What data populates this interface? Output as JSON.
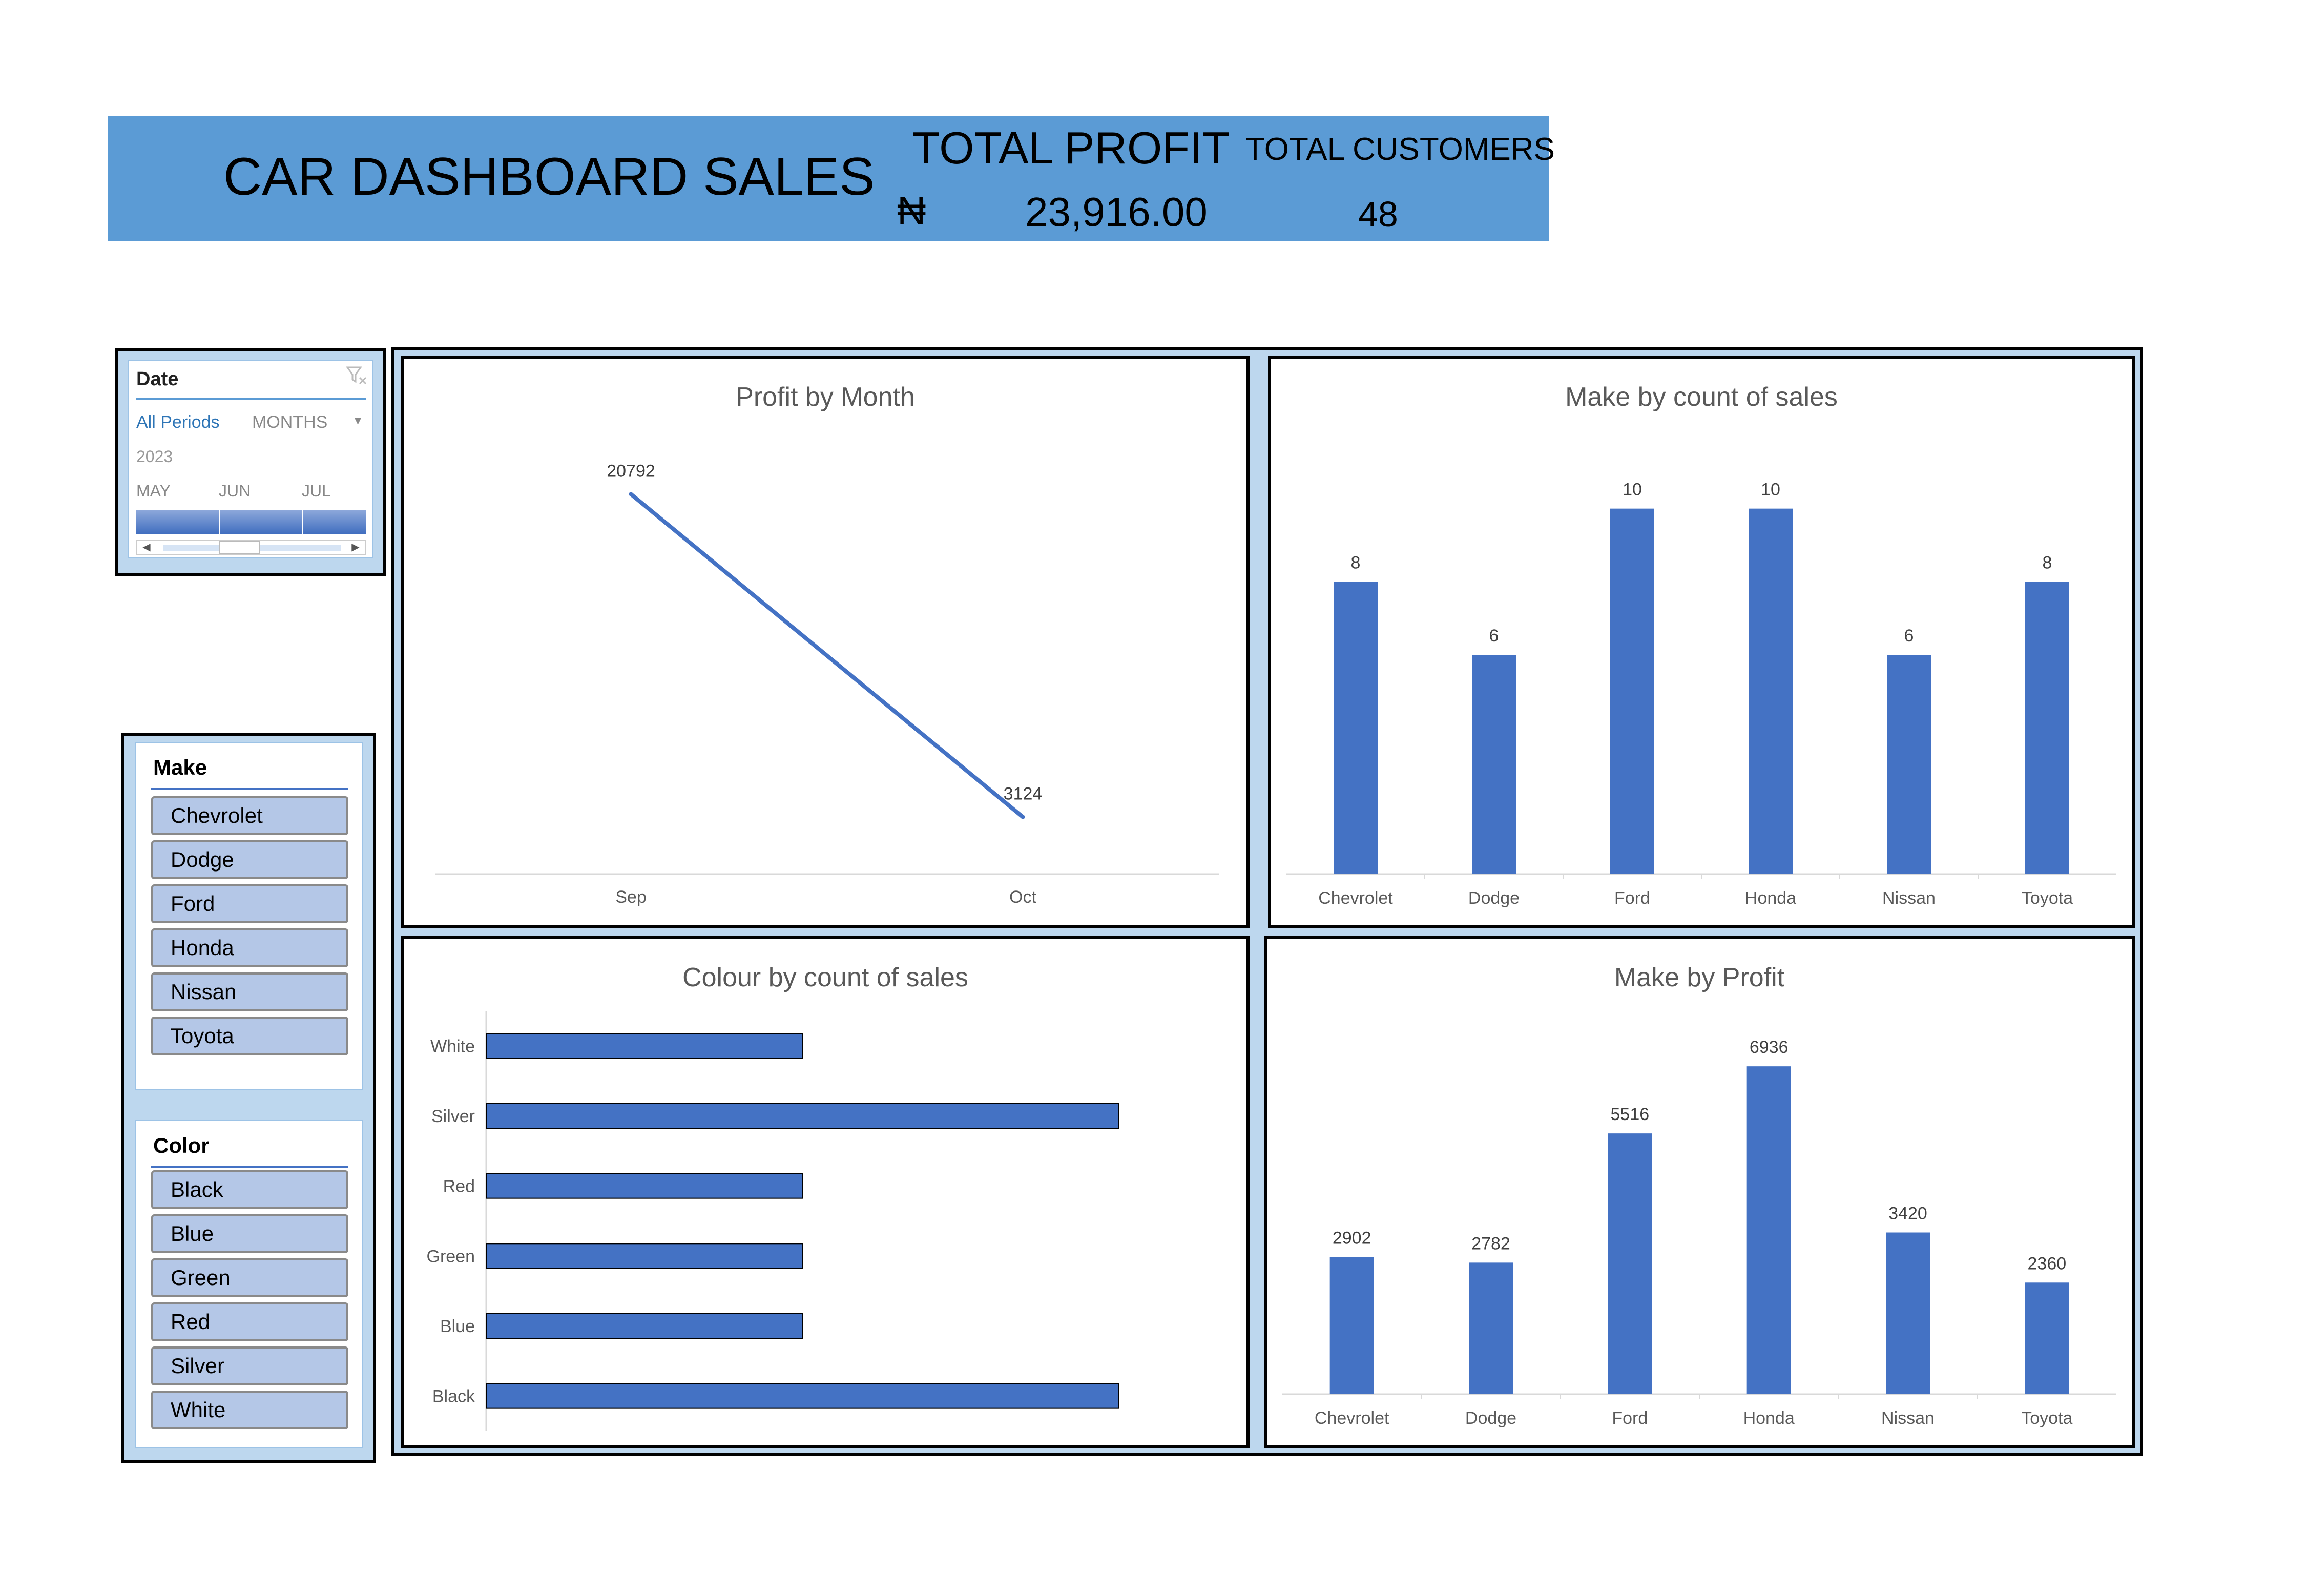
{
  "header": {
    "title": "CAR DASHBOARD SALES",
    "profit_label": "TOTAL PROFIT",
    "currency_symbol": "₦",
    "profit_value": "23,916.00",
    "customers_label": "TOTAL CUSTOMERS",
    "customers_value": "48"
  },
  "date_slicer": {
    "title": "Date",
    "all_periods": "All Periods",
    "level": "MONTHS",
    "year": "2023",
    "months": [
      "MAY",
      "JUN",
      "JUL"
    ]
  },
  "make_slicer": {
    "title": "Make",
    "items": [
      "Chevrolet",
      "Dodge",
      "Ford",
      "Honda",
      "Nissan",
      "Toyota"
    ]
  },
  "color_slicer": {
    "title": "Color",
    "items": [
      "Black",
      "Blue",
      "Green",
      "Red",
      "Silver",
      "White"
    ]
  },
  "colors": {
    "accent": "#4472c4",
    "banner": "#5b9bd5",
    "panel_bg": "#bdd7ee"
  },
  "chart_data": [
    {
      "id": "profit_by_month",
      "type": "line",
      "title": "Profit by Month",
      "categories": [
        "Sep",
        "Oct"
      ],
      "values": [
        20792,
        3124
      ],
      "ylim": [
        0,
        24000
      ],
      "grid": false,
      "legend": "none",
      "color": "#4472c4"
    },
    {
      "id": "make_by_count",
      "type": "bar",
      "title": "Make by count of sales",
      "categories": [
        "Chevrolet",
        "Dodge",
        "Ford",
        "Honda",
        "Nissan",
        "Toyota"
      ],
      "values": [
        8,
        6,
        10,
        10,
        6,
        8
      ],
      "ylim": [
        0,
        12
      ],
      "grid": false,
      "legend": "none",
      "color": "#4472c4"
    },
    {
      "id": "colour_by_count",
      "type": "bar",
      "orientation": "horizontal",
      "title": "Colour by count of sales",
      "categories": [
        "White",
        "Silver",
        "Red",
        "Green",
        "Blue",
        "Black"
      ],
      "values": [
        6,
        12,
        6,
        6,
        6,
        12
      ],
      "xlim": [
        0,
        14
      ],
      "grid": false,
      "legend": "none",
      "color": "#4472c4"
    },
    {
      "id": "make_by_profit",
      "type": "bar",
      "title": "Make by Profit",
      "categories": [
        "Chevrolet",
        "Dodge",
        "Ford",
        "Honda",
        "Nissan",
        "Toyota"
      ],
      "values": [
        2902,
        2782,
        5516,
        6936,
        3420,
        2360
      ],
      "ylim": [
        0,
        8000
      ],
      "grid": false,
      "legend": "none",
      "color": "#4472c4"
    }
  ]
}
